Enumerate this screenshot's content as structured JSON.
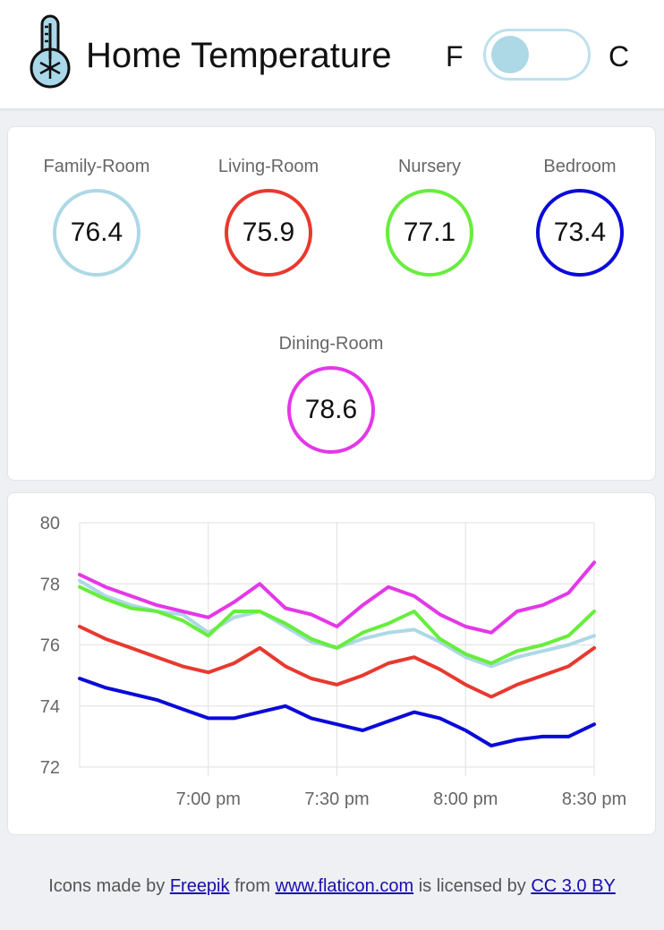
{
  "header": {
    "title": "Home Temperature",
    "unit_left": "F",
    "unit_right": "C",
    "toggle_state": "F"
  },
  "rooms": [
    {
      "name": "Family-Room",
      "value": "76.4",
      "color": "#add8e6"
    },
    {
      "name": "Living-Room",
      "value": "75.9",
      "color": "#e8392f"
    },
    {
      "name": "Nursery",
      "value": "77.1",
      "color": "#66ee3b"
    },
    {
      "name": "Bedroom",
      "value": "73.4",
      "color": "#0a0ad9"
    },
    {
      "name": "Dining-Room",
      "value": "78.6",
      "color": "#e338e8"
    }
  ],
  "chart_data": {
    "type": "line",
    "title": "",
    "xlabel": "",
    "ylabel": "",
    "ylim": [
      72,
      80
    ],
    "yticks": [
      72,
      74,
      76,
      78,
      80
    ],
    "xlim": [
      "6:30 pm",
      "8:30 pm"
    ],
    "xticks": [
      "7:00 pm",
      "7:30 pm",
      "8:00 pm",
      "8:30 pm"
    ],
    "grid": true,
    "x": [
      "6:30",
      "6:36",
      "6:42",
      "6:48",
      "6:54",
      "7:00",
      "7:06",
      "7:12",
      "7:18",
      "7:24",
      "7:30",
      "7:36",
      "7:42",
      "7:48",
      "7:54",
      "8:00",
      "8:06",
      "8:12",
      "8:18",
      "8:24",
      "8:30"
    ],
    "series": [
      {
        "color": "#add8e6",
        "values": [
          78.1,
          77.6,
          77.3,
          77.1,
          77.0,
          76.4,
          76.9,
          77.1,
          76.6,
          76.1,
          75.9,
          76.2,
          76.4,
          76.5,
          76.1,
          75.6,
          75.3,
          75.6,
          75.8,
          76.0,
          76.3
        ]
      },
      {
        "color": "#e8392f",
        "values": [
          76.6,
          76.2,
          75.9,
          75.6,
          75.3,
          75.1,
          75.4,
          75.9,
          75.3,
          74.9,
          74.7,
          75.0,
          75.4,
          75.6,
          75.2,
          74.7,
          74.3,
          74.7,
          75.0,
          75.3,
          75.9
        ]
      },
      {
        "color": "#66ee3b",
        "values": [
          77.9,
          77.5,
          77.2,
          77.1,
          76.8,
          76.3,
          77.1,
          77.1,
          76.7,
          76.2,
          75.9,
          76.4,
          76.7,
          77.1,
          76.2,
          75.7,
          75.4,
          75.8,
          76.0,
          76.3,
          77.1
        ]
      },
      {
        "color": "#0a0ad9",
        "values": [
          74.9,
          74.6,
          74.4,
          74.2,
          73.9,
          73.6,
          73.6,
          73.8,
          74.0,
          73.6,
          73.4,
          73.2,
          73.5,
          73.8,
          73.6,
          73.2,
          72.7,
          72.9,
          73.0,
          73.0,
          73.4
        ]
      },
      {
        "color": "#e338e8",
        "values": [
          78.3,
          77.9,
          77.6,
          77.3,
          77.1,
          76.9,
          77.4,
          78.0,
          77.2,
          77.0,
          76.6,
          77.3,
          77.9,
          77.6,
          77.0,
          76.6,
          76.4,
          77.1,
          77.3,
          77.7,
          78.7
        ]
      }
    ]
  },
  "footer": {
    "prefix": "Icons made by ",
    "author": "Freepik",
    "mid1": " from ",
    "site": "www.flaticon.com",
    "mid2": " is licensed by ",
    "license": "CC 3.0 BY"
  }
}
